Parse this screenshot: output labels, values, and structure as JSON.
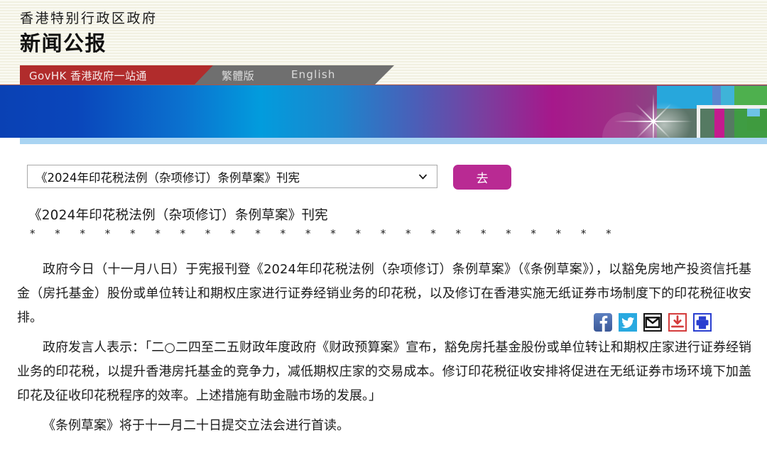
{
  "masthead": {
    "org": "香港特别行政区政府",
    "title": "新闻公报"
  },
  "tabs": {
    "govhk": "GovHK 香港政府一站通",
    "traditional": "繁體版",
    "english": "English"
  },
  "controls": {
    "select_value": "《2024年印花税法例（杂项修订）条例草案》刊宪",
    "go_label": "去",
    "caret_icon": "chevron-down-icon"
  },
  "social": [
    {
      "name": "facebook-icon",
      "glyph": "f",
      "color": "#3b5998"
    },
    {
      "name": "twitter-icon",
      "glyph": "ᴠ",
      "color": "#29a9e0"
    },
    {
      "name": "email-icon",
      "glyph": "✉",
      "color": "#141414"
    },
    {
      "name": "download-icon",
      "glyph": "⬇",
      "color": "#d43c3c"
    },
    {
      "name": "print-icon",
      "glyph": "⎙",
      "color": "#2a3fd0"
    }
  ],
  "article": {
    "title": "《2024年印花税法例（杂项修订）条例草案》刊宪",
    "separator": "* * * * * * * * * * * * * * * * * * * * * * * *",
    "paragraphs": [
      "政府今日（十一月八日）于宪报刊登《2024年印花税法例（杂项修订）条例草案》（《条例草案》），以豁免房地产投资信托基金（房托基金）股份或单位转让和期权庄家进行证券经销业务的印花税，以及修订在香港实施无纸证券市场制度下的印花税征收安排。",
      "政府发言人表示：「二○二四至二五财政年度政府《财政预算案》宣布，豁免房托基金股份或单位转让和期权庄家进行证券经销业务的印花税，以提升香港房托基金的竞争力，减低期权庄家的交易成本。修订印花税征收安排将促进在无纸证券市场环境下加盖印花及征收印花税程序的效率。上述措施有助金融市场的发展。」",
      "《条例草案》将于十一月二十日提交立法会进行首读。"
    ]
  },
  "colors": {
    "masthead_bg": "#f4f3e4",
    "tab_red": "#b12c2c",
    "tab_gray": "#6f6f6f",
    "go_button": "#b92a93",
    "banner_underline": "#a9d4f2"
  }
}
